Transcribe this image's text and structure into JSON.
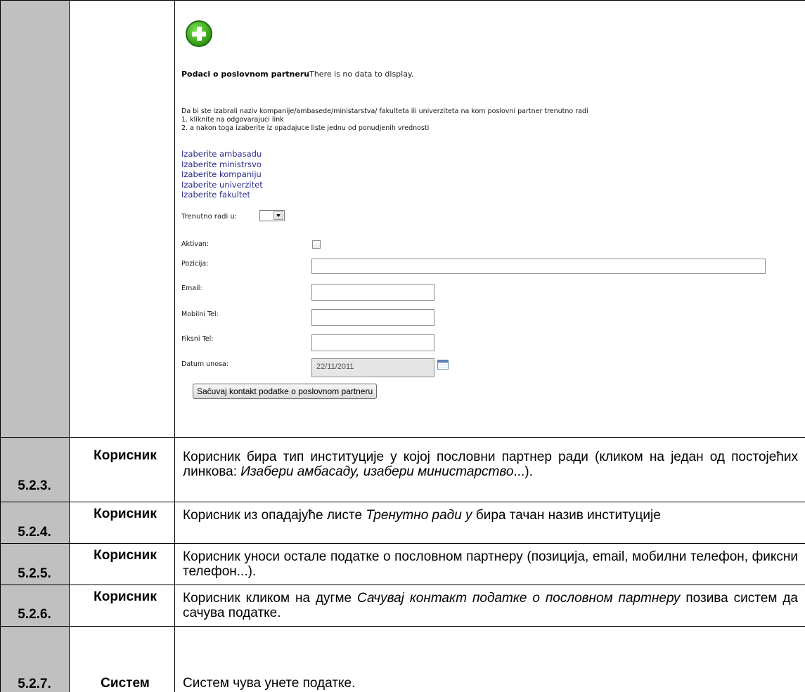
{
  "screenshot": {
    "heading_bold": "Podaci o poslovnom partneru",
    "heading_rest": "There is no data to display.",
    "instructions": [
      "Da bi ste izabrali naziv kompanije/ambasede/ministarstva/ fakulteta ili univerziteta na kom poslovni partner trenutno radi",
      "1. kliknite na odgovarajuci link",
      "2. a nakon toga izaberite iz opadajuce liste jednu od ponudjenih vrednosti"
    ],
    "links": [
      "Izaberite ambasadu",
      "Izaberite ministrsvo",
      "Izaberite kompaniju",
      "Izaberite univerzitet",
      "Izaberite fakultet"
    ],
    "trenutno_label": "Trenutno radi u:",
    "aktivan_label": "Aktivan:",
    "pozicija_label": "Pozicija:",
    "email_label": "Email:",
    "mobilni_label": "Mobilni Tel:",
    "fiksni_label": "Fiksni Tel:",
    "datum_label": "Datum unosa:",
    "datum_value": "22/11/2011",
    "save_button": "Sačuvaj kontakt podatke o poslovnom partneru"
  },
  "rows": [
    {
      "num": "5.2.3.",
      "actor": "Корисник"
    },
    {
      "num": "5.2.4.",
      "actor": "Корисник"
    },
    {
      "num": "5.2.5.",
      "actor": "Корисник"
    },
    {
      "num": "5.2.6.",
      "actor": "Корисник"
    },
    {
      "num": "5.2.7.",
      "actor": "Систем"
    }
  ],
  "desc": {
    "r1_a": "Корисник бира тип институције у којој пословни партнер ради (кликом на један од постојећих линкова: ",
    "r1_i": "Изабери амбасаду, изабери министарство",
    "r1_b": "...).",
    "r2_a": "Корисник из опадајуће листе ",
    "r2_i": "Тренутно ради у",
    "r2_b": " бира тачан назив институције",
    "r3": "Корисник уноси остале податке о пословном партнеру (позиција, email, мобилни телефон, фиксни телефон...).",
    "r4_a": "Корисник кликом на дугме ",
    "r4_i": "Сачувај контакт податке о пословном партнеру",
    "r4_b": " позива систем да сачува податке.",
    "r5": "Систем чува унете податке."
  }
}
